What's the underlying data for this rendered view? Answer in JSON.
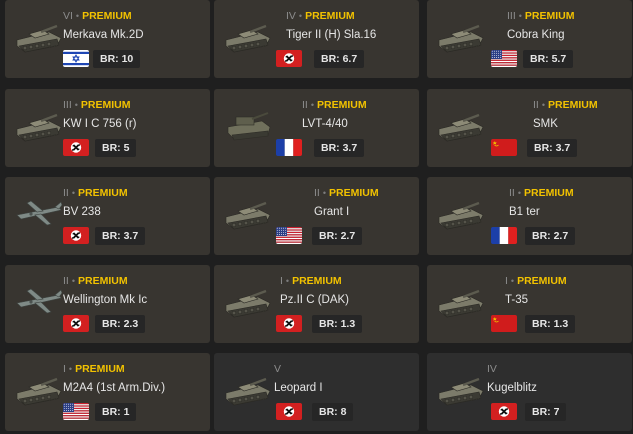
{
  "vehicles": [
    {
      "rank": "VI",
      "premium": "PREMIUM",
      "name": "Merkava Mk.2D",
      "flag": "israel",
      "br": "BR: 10"
    },
    {
      "rank": "IV",
      "premium": "PREMIUM",
      "name": "Tiger II (H) Sla.16",
      "flag": "germany",
      "br": "BR: 6.7"
    },
    {
      "rank": "III",
      "premium": "PREMIUM",
      "name": "Cobra King",
      "flag": "usa",
      "br": "BR: 5.7"
    },
    {
      "rank": "III",
      "premium": "PREMIUM",
      "name": "KW I C 756 (r)",
      "flag": "germany",
      "br": "BR: 5"
    },
    {
      "rank": "II",
      "premium": "PREMIUM",
      "name": "LVT-4/40",
      "flag": "france",
      "br": "BR: 3.7"
    },
    {
      "rank": "II",
      "premium": "PREMIUM",
      "name": "SMK",
      "flag": "ussr",
      "br": "BR: 3.7"
    },
    {
      "rank": "II",
      "premium": "PREMIUM",
      "name": "BV 238",
      "flag": "germany",
      "br": "BR: 3.7"
    },
    {
      "rank": "II",
      "premium": "PREMIUM",
      "name": "Grant I",
      "flag": "usa",
      "br": "BR: 2.7"
    },
    {
      "rank": "II",
      "premium": "PREMIUM",
      "name": "B1 ter",
      "flag": "france",
      "br": "BR: 2.7"
    },
    {
      "rank": "II",
      "premium": "PREMIUM",
      "name": "Wellington Mk Ic",
      "flag": "germany",
      "br": "BR: 2.3"
    },
    {
      "rank": "I",
      "premium": "PREMIUM",
      "name": "Pz.II C (DAK)",
      "flag": "germany",
      "br": "BR: 1.3"
    },
    {
      "rank": "I",
      "premium": "PREMIUM",
      "name": "T-35",
      "flag": "ussr",
      "br": "BR: 1.3"
    },
    {
      "rank": "I",
      "premium": "PREMIUM",
      "name": "M2A4 (1st Arm.Div.)",
      "flag": "usa",
      "br": "BR: 1"
    },
    {
      "rank": "V",
      "premium": "",
      "name": "Leopard I",
      "flag": "germany",
      "br": "BR: 8"
    },
    {
      "rank": "IV",
      "premium": "",
      "name": "Kugelblitz",
      "flag": "germany",
      "br": "BR: 7"
    }
  ],
  "vehicle_types": [
    "tank",
    "tank",
    "tank",
    "tank",
    "spg",
    "tank",
    "plane",
    "tank",
    "tank",
    "plane",
    "tank",
    "tank",
    "tank",
    "tank",
    "tank"
  ],
  "colors": {
    "premium": "#f2c200",
    "card": "#383530",
    "card_regular": "#2e2e2e",
    "background": "#1f1f1f"
  }
}
